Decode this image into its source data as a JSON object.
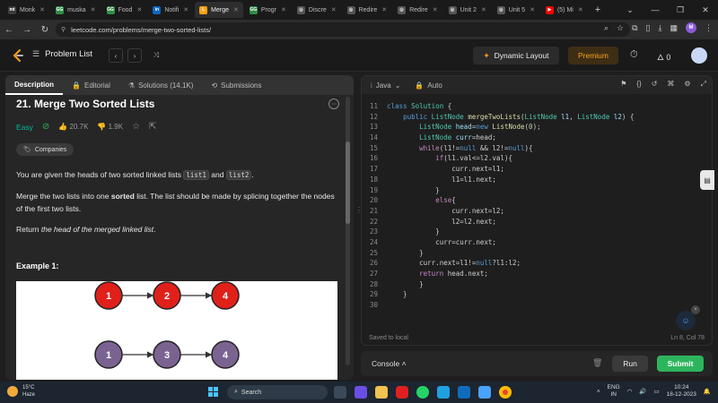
{
  "browser": {
    "tabs": [
      {
        "label": "Monk",
        "icon": "monkeytype-icon",
        "color": "#3c3c3c",
        "glyph": "mt"
      },
      {
        "label": "muska",
        "icon": "gfg-icon",
        "color": "#2f8d46",
        "glyph": "GG"
      },
      {
        "label": "Food",
        "icon": "gfg-icon",
        "color": "#2f8d46",
        "glyph": "GG"
      },
      {
        "label": "Notifi",
        "icon": "linkedin-icon",
        "color": "#0a66c2",
        "glyph": "in"
      },
      {
        "label": "Merge",
        "icon": "leetcode-icon",
        "color": "#ffa116",
        "glyph": "L",
        "active": true
      },
      {
        "label": "Progr",
        "icon": "gfg-icon",
        "color": "#2f8d46",
        "glyph": "GG"
      },
      {
        "label": "Discre",
        "icon": "globe-icon",
        "color": "#555555",
        "glyph": "◎"
      },
      {
        "label": "Redire",
        "icon": "globe-icon",
        "color": "#555555",
        "glyph": "◎"
      },
      {
        "label": "Redire",
        "icon": "globe-icon",
        "color": "#555555",
        "glyph": "◎"
      },
      {
        "label": "Unit 2",
        "icon": "globe-icon",
        "color": "#555555",
        "glyph": "◎"
      },
      {
        "label": "Unit 5",
        "icon": "globe-icon",
        "color": "#555555",
        "glyph": "◎"
      },
      {
        "label": "(5) Mi",
        "icon": "youtube-icon",
        "color": "#ff0000",
        "glyph": "▶"
      }
    ],
    "new_tab": "+",
    "url": "leetcode.com/problems/merge-two-sorted-lists/",
    "profile_initial": "M"
  },
  "lc_nav": {
    "problem_list": "Problem List",
    "dynamic_layout": "Dynamic Layout",
    "premium": "Premium",
    "streak_count": "0"
  },
  "left_tabs": [
    {
      "label": "Description",
      "icon": "description-icon",
      "glyph": "",
      "active": true
    },
    {
      "label": "Editorial",
      "icon": "lock-icon",
      "glyph": "🔒"
    },
    {
      "label": "Solutions (14.1K)",
      "icon": "flask-icon",
      "glyph": "⚗"
    },
    {
      "label": "Submissions",
      "icon": "history-icon",
      "glyph": "⟲"
    }
  ],
  "problem": {
    "title": "21. Merge Two Sorted Lists",
    "difficulty": "Easy",
    "likes": "20.7K",
    "dislikes": "1.9K",
    "companies": "Companies",
    "p1_a": "You are given the heads of two sorted linked lists ",
    "p1_code1": "list1",
    "p1_and": " and ",
    "p1_code2": "list2",
    "p1_end": ".",
    "p2_a": "Merge the two lists into one ",
    "p2_bold": "sorted",
    "p2_b": " list. The list should be made by splicing together the nodes of the first two lists.",
    "p3_a": "Return ",
    "p3_em": "the head of the merged linked list",
    "p3_end": ".",
    "example_title": "Example 1:",
    "diagram": {
      "row1": [
        "1",
        "2",
        "4"
      ],
      "row2": [
        "1",
        "3",
        "4"
      ],
      "row1_color": "#e0201a",
      "row2_color": "#7b6391"
    }
  },
  "editor": {
    "language": "Java",
    "mode": "Auto",
    "status": "Saved to local",
    "cursor": "Ln 8, Col 78",
    "lines": [
      {
        "n": "11",
        "html": "<span class='kw'>class</span> <span class='ty'>Solution</span> {"
      },
      {
        "n": "12",
        "html": "    <span class='kw'>public</span> <span class='ty'>ListNode</span> <span class='fn'>mergeTwoLists</span>(<span class='ty'>ListNode</span> <span class='vr'>l1</span>, <span class='ty'>ListNode</span> <span class='vr'>l2</span>) {"
      },
      {
        "n": "13",
        "html": "        <span class='ty'>ListNode</span> <span class='vr'>head</span>=<span class='kw'>new</span> <span class='fn'>ListNode</span>(<span class='nm'>0</span>);"
      },
      {
        "n": "14",
        "html": "        <span class='ty'>ListNode</span> <span class='vr'>curr</span>=head;"
      },
      {
        "n": "15",
        "html": "        <span class='kw2'>while</span>(l1!=<span class='kw'>null</span> &amp;&amp; l2!=<span class='kw'>null</span>){"
      },
      {
        "n": "16",
        "html": "            <span class='kw2'>if</span>(l1.val&lt;=l2.val){"
      },
      {
        "n": "17",
        "html": "                curr.next=l1;"
      },
      {
        "n": "18",
        "html": "                l1=l1.next;"
      },
      {
        "n": "19",
        "html": "            }"
      },
      {
        "n": "20",
        "html": "            <span class='kw2'>else</span>{"
      },
      {
        "n": "21",
        "html": "                curr.next=l2;"
      },
      {
        "n": "22",
        "html": "                l2=l2.next;"
      },
      {
        "n": "23",
        "html": "            }"
      },
      {
        "n": "24",
        "html": "            curr=curr.next;"
      },
      {
        "n": "25",
        "html": "        }"
      },
      {
        "n": "26",
        "html": "        curr.next=l1!=<span class='kw'>null</span>?l1:l2;"
      },
      {
        "n": "27",
        "html": "        <span class='kw2'>return</span> head.next;"
      },
      {
        "n": "28",
        "html": "        }"
      },
      {
        "n": "29",
        "html": "    }"
      },
      {
        "n": "30",
        "html": ""
      }
    ]
  },
  "console": {
    "label": "Console",
    "run": "Run",
    "submit": "Submit"
  },
  "taskbar": {
    "temp": "15°C",
    "weather": "Haze",
    "search": "Search",
    "lang1": "ENG",
    "lang2": "IN",
    "time": "10:24",
    "date": "18-12-2023"
  },
  "colors": {
    "accent": "#ffa116",
    "submit": "#2db55d",
    "easy": "#00b8a3"
  }
}
